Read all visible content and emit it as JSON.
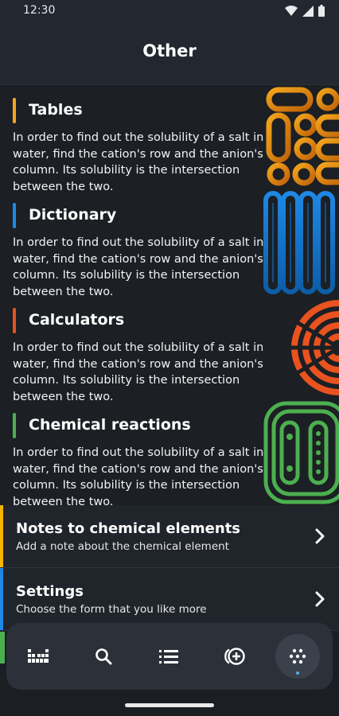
{
  "status_bar": {
    "time": "12:30"
  },
  "header": {
    "title": "Other"
  },
  "cards": [
    {
      "title": "Tables",
      "description": "In order to find out the solubility of a salt in water, find the cation's row and the anion's column. Its solubility is the intersection between the two.",
      "accent": "#f4a51c"
    },
    {
      "title": "Dictionary",
      "description": "In order to find out the solubility of a salt in water, find the cation's row and the anion's column. Its solubility is the intersection between the two.",
      "accent": "#1e88e5"
    },
    {
      "title": "Calculators",
      "description": "In order to find out the solubility of a salt in water, find the cation's row and the anion's column. Its solubility is the intersection between the two.",
      "accent": "#e8531f"
    },
    {
      "title": "Chemical reactions",
      "description": "In order to find out the solubility of a salt in water, find the cation's row and the anion's column. Its solubility is the intersection between the two.",
      "accent": "#4caf50"
    }
  ],
  "rows": [
    {
      "title": "Notes to chemical elements",
      "subtitle": "Add a note about the chemical element",
      "accent": "#f4b400"
    },
    {
      "title": "Settings",
      "subtitle": "Choose the form that you like more",
      "accent": "#1e88e5"
    }
  ],
  "bottom_nav": [
    {
      "icon": "periodic-table-icon",
      "active": false
    },
    {
      "icon": "search-icon",
      "active": false
    },
    {
      "icon": "list-icon",
      "active": false
    },
    {
      "icon": "add-reaction-icon",
      "active": false
    },
    {
      "icon": "more-dots-icon",
      "active": true
    }
  ]
}
